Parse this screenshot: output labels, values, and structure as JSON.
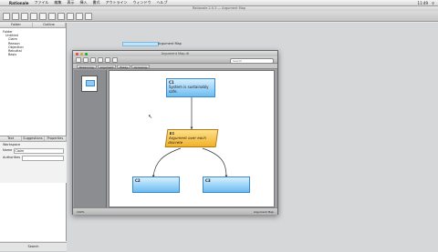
{
  "menubar": {
    "items": [
      "Rationale",
      "ファイル",
      "編集",
      "表示",
      "挿入",
      "書式",
      "アウトライン",
      "ウィンドウ",
      "ヘルプ"
    ],
    "clock": "11:49"
  },
  "app": {
    "title": "Rationale 2.0.3 — Argument Map"
  },
  "left_panel": {
    "tabs": [
      "Folder",
      "Outline"
    ],
    "tree": [
      "Folder",
      "Untitled",
      "Claim",
      "Reason",
      "Objection",
      "Rebuttal",
      "Basis"
    ],
    "prop_tabs": [
      "Text",
      "Suggestions",
      "Properties"
    ],
    "props": [
      {
        "label": "Workspace",
        "value": ""
      },
      {
        "label": "Name",
        "value": "Claim"
      },
      {
        "label": "Authorities",
        "value": ""
      }
    ],
    "bottom_label": "Search"
  },
  "toolbar_mini_label": "Argument Map",
  "doc": {
    "title": "Argument Map.rtl",
    "search_placeholder": "Search",
    "tabs": [
      "Reasoning",
      "Argument",
      "Essay",
      "Grouping"
    ],
    "status_left": "100%",
    "status_right": "Argument Map"
  },
  "nodes": [
    {
      "id": "C1",
      "text": "System is sustainably safe.",
      "style": "blue"
    },
    {
      "id": "E1",
      "text": "Argument over each discrete",
      "style": "orange"
    },
    {
      "id": "C2",
      "text": "",
      "style": "blue"
    },
    {
      "id": "C3",
      "text": "",
      "style": "blue"
    }
  ],
  "colors": {
    "claim_fill": "#8fccf5",
    "strategy_fill": "#f2bb3a",
    "canvas": "#ffffff"
  }
}
